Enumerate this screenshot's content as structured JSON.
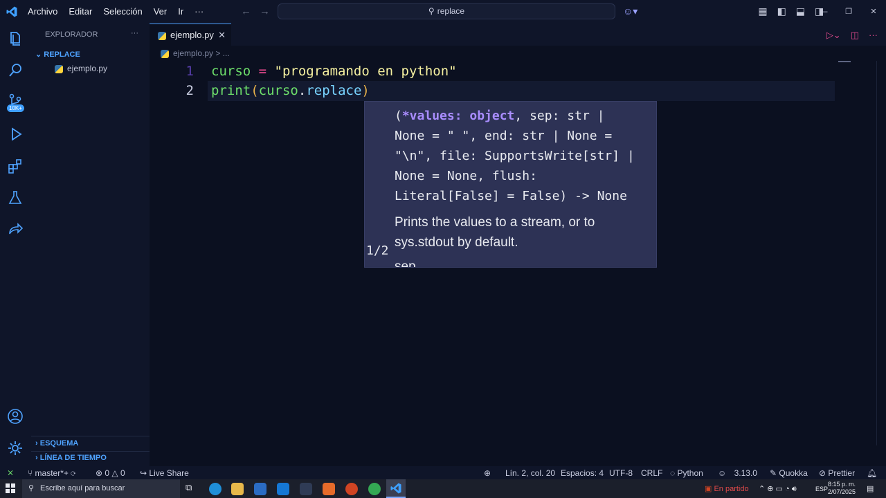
{
  "menu": [
    "Archivo",
    "Editar",
    "Selección",
    "Ver",
    "Ir",
    "···"
  ],
  "search": {
    "text": "replace"
  },
  "sidebar": {
    "title": "EXPLORADOR",
    "dots": "···",
    "folder": "REPLACE",
    "file": "ejemplo.py",
    "outline": "ESQUEMA",
    "timeline": "LÍNEA DE TIEMPO"
  },
  "activity": {
    "badge": "10K+"
  },
  "tab": {
    "name": "ejemplo.py",
    "close": "✕"
  },
  "breadcrumb": {
    "file": "ejemplo.py",
    "rest": "> ..."
  },
  "editor": {
    "lines": [
      {
        "num": "1"
      },
      {
        "num": "2"
      }
    ],
    "line1": {
      "var": "curso",
      "op": " = ",
      "str": "\"programando en python\""
    },
    "line2": {
      "fn": "print",
      "open": "(",
      "obj": "curso",
      "dot": ".",
      "method": "replace",
      "close": ")"
    }
  },
  "tooltip": {
    "sig_open": "(",
    "sig_param": "*values: object",
    "sig_rest1": ", sep: str |",
    "sig_line2": "None = \" \", end: str | None =",
    "sig_line3": "\"\\n\", file: SupportsWrite[str] |",
    "sig_line4": "None = None, flush:",
    "sig_line5": "Literal[False] = False) -> None",
    "doc": "Prints the values to a stream, or to sys.stdout by default.",
    "doc_more": "sep",
    "counter": "1/2"
  },
  "status": {
    "branch": "master*+",
    "errors": "0",
    "warnings": "0",
    "liveshare": "Live Share",
    "position": "Lín. 2, col. 20",
    "spaces": "Espacios: 4",
    "encoding": "UTF-8",
    "eol": "CRLF",
    "language": "Python",
    "version": "3.13.0",
    "quokka": "Quokka",
    "prettier": "Prettier"
  },
  "taskbar": {
    "search_placeholder": "Escribe aquí para buscar",
    "weather": "En partido",
    "lang": "ESP",
    "time": "8:15 p. m.",
    "date": "2/07/2025"
  },
  "colors": {
    "accent": "#4fa3ff",
    "tooltip_bg": "#2d3255",
    "editor_bg": "#0b1020"
  }
}
